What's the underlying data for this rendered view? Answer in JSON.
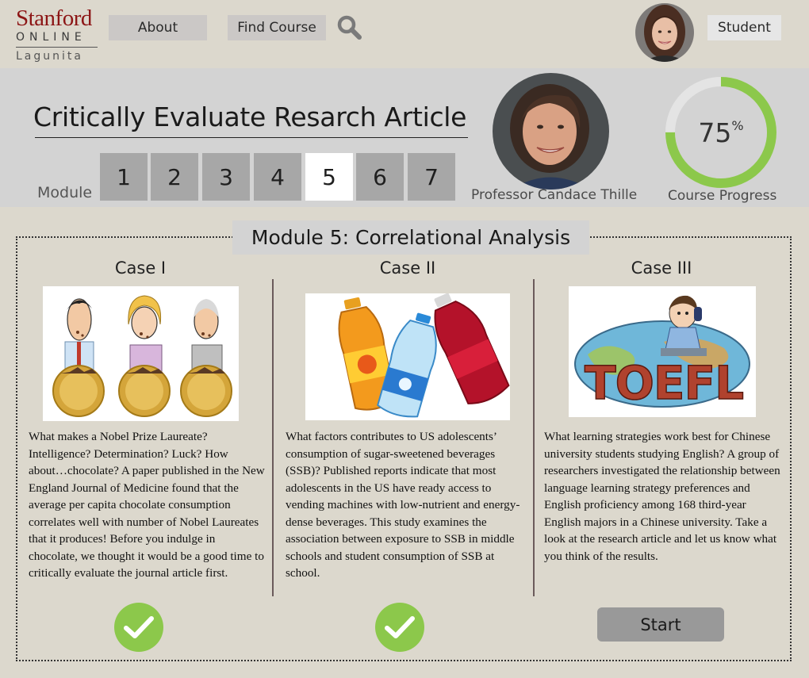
{
  "logo": {
    "line1": "Stanford",
    "line2": "ONLINE",
    "line3": "Lagunita"
  },
  "nav": {
    "about": "About",
    "find_course": "Find Course",
    "user_role": "Student"
  },
  "icons": {
    "search": "search-icon",
    "check": "checkmark-icon"
  },
  "course": {
    "title": "Critically Evaluate Resarch Article",
    "module_label": "Module",
    "modules": [
      "1",
      "2",
      "3",
      "4",
      "5",
      "6",
      "7"
    ],
    "active_module": "5",
    "professor": "Professor Candace Thille",
    "progress_value": "75",
    "progress_unit": "%",
    "progress_fraction": 0.75,
    "progress_label": "Course Progress"
  },
  "module": {
    "heading": "Module 5: Correlational Analysis",
    "cases": [
      {
        "title": "Case I",
        "text": "What makes a Nobel Prize Laureate? Intelligence? Determination? Luck? How about…chocolate? A paper published in the New England Journal of Medicine found that the average per capita chocolate consumption correlates well with number of Nobel Laureates that it produces! Before you indulge in chocolate, we thought it would be a good time to critically evaluate the journal article first.",
        "status": "completed"
      },
      {
        "title": "Case II",
        "text": "What factors contributes to US adolescents’ consumption of sugar-sweetened beverages (SSB)? Published reports indicate that most adolescents in the US have ready access to vending machines with low-nutrient and energy-dense beverages. This study examines the association between exposure to SSB in middle schools and student consumption of SSB at school.",
        "status": "completed"
      },
      {
        "title": "Case III",
        "text": "What learning strategies work best for Chinese university students studying English? A group of researchers investigated the relationship between language learning strategy preferences and English proficiency among 168 third-year English majors in a Chinese university. Take a look at the research article and let us know what you think of the results.",
        "status": "not-started",
        "action": "Start"
      }
    ],
    "toefl_word": "TOEFL"
  },
  "colors": {
    "background": "#dcd8cd",
    "band": "#d3d3d3",
    "stanford_red": "#8c1515",
    "progress_green": "#8cc84b",
    "check_green": "#8cc84b",
    "module_button": "#a7a7a7",
    "module_button_active": "#ffffff"
  }
}
